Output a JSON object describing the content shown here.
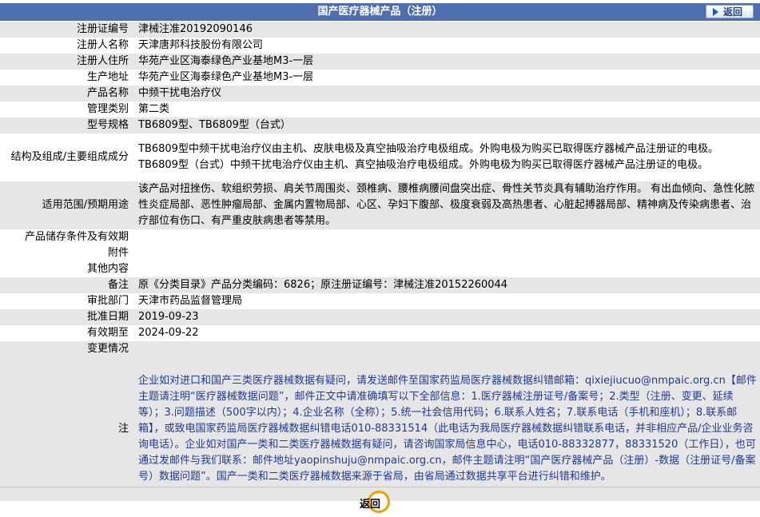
{
  "header": {
    "title": "国产医疗器械产品（注册）",
    "back_label": "返回"
  },
  "rows": [
    {
      "label": "注册证编号",
      "value": "津械注准20192090146"
    },
    {
      "label": "注册人名称",
      "value": "天津唐邦科技股份有限公司"
    },
    {
      "label": "注册人住所",
      "value": "华苑产业区海泰绿色产业基地M3-一层"
    },
    {
      "label": "生产地址",
      "value": "华苑产业区海泰绿色产业基地M3-一层"
    },
    {
      "label": "产品名称",
      "value": "中频干扰电治疗仪"
    },
    {
      "label": "管理类别",
      "value": "第二类"
    },
    {
      "label": "型号规格",
      "value": "TB6809型、TB6809型（台式）"
    },
    {
      "label": "结构及组成/主要组成成分",
      "value": "TB6809型中频干扰电治疗仪由主机、皮肤电极及真空抽吸治疗电极组成。外购电极为购买已取得医疗器械产品注册证的电极。TB6809型（台式）中频干扰电治疗仪由主机、真空抽吸治疗电极组成。外购电极为购买已取得医疗器械产品注册证的电极。"
    },
    {
      "label": "适用范围/预期用途",
      "value": "该产品对扭挫伤、软组织劳损、肩关节周围炎、颈椎病、腰椎病腰间盘突出症、骨性关节炎具有辅助治疗作用。 有出血倾向、急性化脓性炎症局部、恶性肿瘤局部、金属内置物局部、心区、孕妇下腹部、极度衰弱及高热患者、心脏起搏器局部、精神病及传染病患者、治疗部位有伤口、有严重皮肤病患者等禁用。"
    },
    {
      "label": "产品储存条件及有效期",
      "value": ""
    },
    {
      "label": "附件",
      "value": ""
    },
    {
      "label": "其他内容",
      "value": ""
    },
    {
      "label": "备注",
      "value": "原《分类目录》产品分类编码：6826；原注册证编号：津械注准20152260044"
    },
    {
      "label": "审批部门",
      "value": "天津市药品监督管理局"
    },
    {
      "label": "批准日期",
      "value": "2019-09-23"
    },
    {
      "label": "有效期至",
      "value": "2024-09-22"
    },
    {
      "label": "变更情况",
      "value": ""
    }
  ],
  "note": {
    "label": "注",
    "text": "企业如对进口和国产三类医疗器械数据有疑问，请发送邮件至国家药监局医疗器械数据纠错邮箱：qixiejiucuo@nmpaic.org.cn【邮件主题请注明“医疗器械数据问题”，邮件正文中请准确填写以下全部信息：1.医疗器械注册证号/备案号；2.类型（注册、变更、延续等）；3.问题描述（500字以内）；4.企业名称（全称）；5.统一社会信用代码；6.联系人姓名；7.联系电话（手机和座机）；8.联系邮箱】，或致电国家药监局医疗器械数据纠错电话010-88331514（此电话为我局医疗器械数据纠错联系电话，并非相应产品/企业业务咨询电话）。企业如对国产一类和二类医疗器械数据有疑问，请咨询国家局信息中心，电话010-88332877，88331520（工作日），也可通过发邮件与我们联系：邮件地址yaopinshuju@nmpaic.org.cn，邮件主题请注明“国产医疗器械产品（注册）-数据（注册证号/备案号）数据问题”。国产一类和二类医疗器械数据来源于省局，由省局通过数据共享平台进行纠错和维护。"
  },
  "footer": {
    "back_label": "返回"
  }
}
